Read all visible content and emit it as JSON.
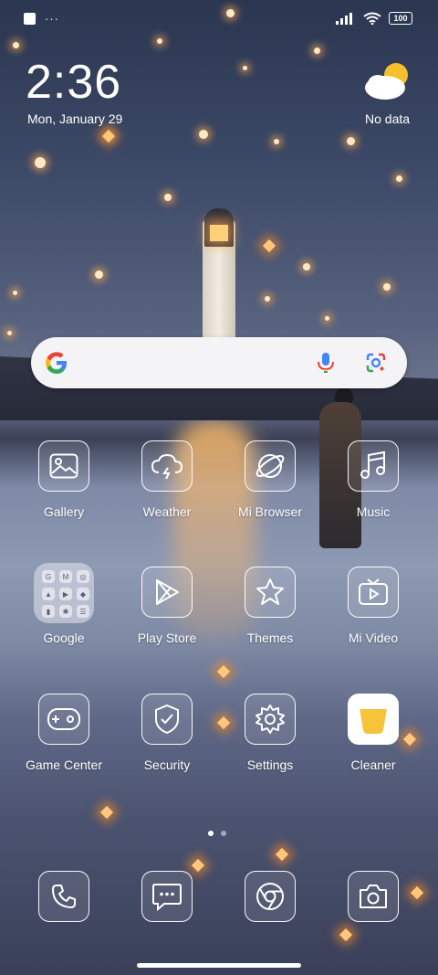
{
  "status_bar": {
    "battery_level": "100"
  },
  "lock_widget": {
    "time": "2:36",
    "date": "Mon, January 29",
    "weather_text": "No data",
    "weather_icon": "partly-cloudy-icon"
  },
  "search_bar": {
    "logo": "google-g-icon",
    "mic_icon": "mic-icon",
    "lens_icon": "google-lens-icon"
  },
  "apps": [
    {
      "label": "Gallery",
      "icon": "gallery-icon"
    },
    {
      "label": "Weather",
      "icon": "weather-icon"
    },
    {
      "label": "Mi Browser",
      "icon": "browser-icon"
    },
    {
      "label": "Music",
      "icon": "music-icon"
    },
    {
      "label": "Google",
      "icon": "folder-icon"
    },
    {
      "label": "Play Store",
      "icon": "play-store-icon"
    },
    {
      "label": "Themes",
      "icon": "themes-icon"
    },
    {
      "label": "Mi Video",
      "icon": "video-icon"
    },
    {
      "label": "Game Center",
      "icon": "game-controller-icon"
    },
    {
      "label": "Security",
      "icon": "shield-check-icon"
    },
    {
      "label": "Settings",
      "icon": "gear-icon"
    },
    {
      "label": "Cleaner",
      "icon": "cleaner-icon"
    }
  ],
  "google_folder_minis": [
    "G",
    "M",
    "◎",
    "▲",
    "▶",
    "◆",
    "▮",
    "✱",
    "☰"
  ],
  "dock": [
    {
      "name": "phone",
      "icon": "phone-icon"
    },
    {
      "name": "messages",
      "icon": "messages-icon"
    },
    {
      "name": "chrome",
      "icon": "chrome-icon"
    },
    {
      "name": "camera",
      "icon": "camera-icon"
    }
  ],
  "page_indicator": {
    "current": 1,
    "total": 2
  },
  "colors": {
    "google_blue": "#4285F4",
    "google_red": "#EA4335",
    "google_yellow": "#FBBC05",
    "google_green": "#34A853",
    "cleaner_yellow": "#F6C33A"
  }
}
